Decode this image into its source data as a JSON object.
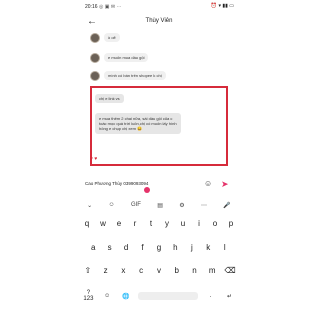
{
  "statusbar": {
    "time": "20:16",
    "extra": "◎ ▣ ✉ ⋯",
    "icons": "⏰ ▾ ▮▮ ▭"
  },
  "header": {
    "back": "←",
    "title": "Thùy Viên"
  },
  "chat": {
    "messages": [
      {
        "text": "ồ oẽ"
      },
      {
        "text": "e muốn mua dầu gội"
      },
      {
        "text": "mình có bán trên shopee k chị"
      }
    ],
    "highlighted": [
      {
        "text": "chị e link vs"
      },
      {
        "text": "e mua thêm 2 chai nữa, sài dầu gội của c toàc mọc quá trời luôn,chị có muốn lấy hình hông e chụp chị xem 😀"
      }
    ],
    "reactions": "♥ ♥"
  },
  "input": {
    "value": "Cao Phương Thùy 0399093094"
  },
  "keyboard": {
    "tools": [
      "⌄",
      "☺",
      "GIF",
      "▤",
      "⚙",
      "⋯",
      "🎤"
    ],
    "row1": [
      "q",
      "w",
      "e",
      "r",
      "t",
      "y",
      "u",
      "i",
      "o",
      "p"
    ],
    "row2": [
      "a",
      "s",
      "d",
      "f",
      "g",
      "h",
      "j",
      "k",
      "l"
    ],
    "row3": [
      "⇧",
      "z",
      "x",
      "c",
      "v",
      "b",
      "n",
      "m",
      "⌫"
    ],
    "bottom": [
      "?123",
      "☺",
      "🌐",
      "",
      ".",
      "↵"
    ]
  },
  "colors": {
    "accent": "#e5336a",
    "highlight_border": "#d62b3b"
  }
}
